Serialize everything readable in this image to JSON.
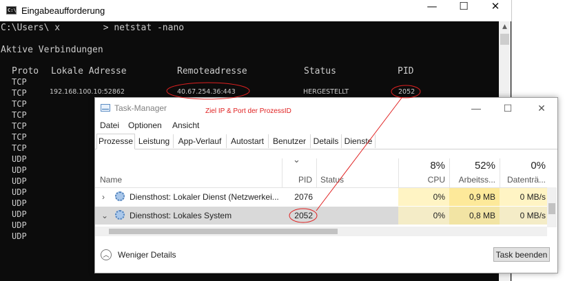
{
  "cmd": {
    "title": "Eingabeaufforderung",
    "icon_text": "C:\\",
    "controls": {
      "minimize": "—",
      "maximize": "☐",
      "close": "✕"
    },
    "prompt": "C:\\Users\\ x        > netstat -nano",
    "section_title": "Aktive Verbindungen",
    "headers": {
      "proto": "Proto",
      "local": "Lokale Adresse",
      "remote": "Remoteadresse",
      "status": "Status",
      "pid": "PID"
    },
    "highlight_row": {
      "proto": "TCP",
      "local": "192.168.100.10:52862",
      "remote": "40.67.254.36:443",
      "status": "HERGESTELLT",
      "pid": "2052"
    },
    "protocols": [
      "TCP",
      "TCP",
      "TCP",
      "TCP",
      "TCP",
      "TCP",
      "TCP",
      "UDP",
      "UDP",
      "UDP",
      "UDP",
      "UDP",
      "UDP",
      "UDP",
      "UDP"
    ],
    "scroll_up_icon": "▲"
  },
  "taskmanager": {
    "title": "Task-Manager",
    "controls": {
      "minimize": "—",
      "maximize": "☐",
      "close": "✕"
    },
    "menu": [
      "Datei",
      "Optionen",
      "Ansicht"
    ],
    "tabs": [
      "Prozesse",
      "Leistung",
      "App-Verlauf",
      "Autostart",
      "Benutzer",
      "Details",
      "Dienste"
    ],
    "active_tab": "Prozesse",
    "columns": {
      "name": "Name",
      "pid": "PID",
      "status": "Status",
      "sort_icon": "⌄",
      "cpu_pct": "8%",
      "cpu": "CPU",
      "mem_pct": "52%",
      "mem": "Arbeitss...",
      "disk_pct": "0%",
      "disk": "Datenträ..."
    },
    "rows": [
      {
        "expand": "›",
        "name": "Diensthost: Lokaler Dienst (Netzwerkei...",
        "pid": "2076",
        "status": "",
        "cpu": "0%",
        "mem": "0,9 MB",
        "disk": "0 MB/s"
      },
      {
        "expand": "⌄",
        "name": "Diensthost: Lokales System",
        "pid": "2052",
        "status": "",
        "cpu": "0%",
        "mem": "0,8 MB",
        "disk": "0 MB/s"
      }
    ],
    "fewer_details": "Weniger Details",
    "fewer_icon": "︿",
    "end_task": "Task beenden"
  },
  "annotation": {
    "text": "Ziel IP & Port der ProzessID",
    "color": "#e02020"
  },
  "colors": {
    "console_bg": "#0c0c0c",
    "console_text": "#cccccc",
    "heat_cpu": "#fff4c4",
    "heat_mem": "#fde99a",
    "selected_row": "#d9d9d9"
  }
}
